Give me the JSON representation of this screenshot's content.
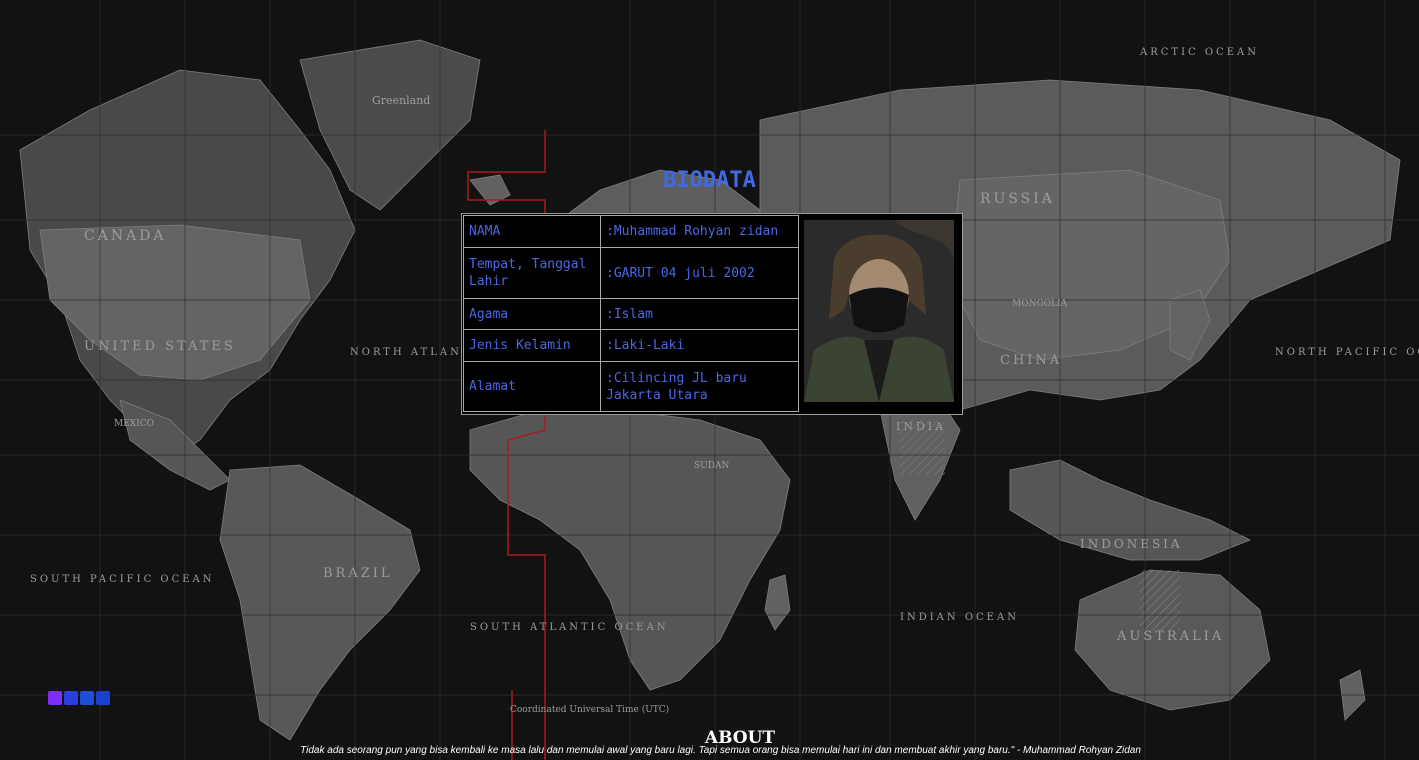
{
  "biodata": {
    "title": "BIODATA",
    "rows": [
      {
        "key": "NAMA",
        "value": ":Muhammad Rohyan zidan"
      },
      {
        "key": "Tempat, Tanggal Lahir",
        "value": ":GARUT 04 juli 2002"
      },
      {
        "key": "Agama",
        "value": ":Islam"
      },
      {
        "key": "Jenis Kelamin",
        "value": ":Laki-Laki"
      },
      {
        "key": "Alamat",
        "value": ":Cilincing JL baru Jakarta Utara"
      }
    ]
  },
  "map": {
    "labels": {
      "greenland": "Greenland",
      "canada": "CANADA",
      "united_states": "UNITED STATES",
      "mexico": "MEXICO",
      "brazil": "BRAZIL",
      "russia": "RUSSIA",
      "china": "CHINA",
      "mongolia": "MONGOLIA",
      "india": "INDIA",
      "australia": "AUSTRALIA",
      "indonesia": "INDONESIA",
      "sudan": "SUDAN",
      "north_atlantic": "NORTH ATLANTIC OCEAN",
      "south_atlantic": "SOUTH ATLANTIC OCEAN",
      "north_pacific": "NORTH PACIFIC OCEAN",
      "south_pacific": "SOUTH PACIFIC OCEAN",
      "indian_ocean": "INDIAN OCEAN",
      "arctic": "ARCTIC OCEAN",
      "utc": "Coordinated Universal Time (UTC)"
    }
  },
  "social": {
    "icons": [
      {
        "name": "facebook-icon",
        "color": "#7b2ff7"
      },
      {
        "name": "twitter-icon",
        "color": "#2a3fe0"
      },
      {
        "name": "instagram-icon",
        "color": "#1f4fd8"
      },
      {
        "name": "linkedin-icon",
        "color": "#1b3fd0"
      }
    ]
  },
  "about": {
    "heading": "ABOUT",
    "quote": "Tidak ada seorang pun yang bisa kembali ke masa lalu dan memulai awal yang baru lagi. Tapi semua orang bisa memulai hari ini dan membuat akhir yang baru.\" - Muhammad Rohyan Zidan"
  },
  "colors": {
    "accent": "#4169e1",
    "table_text": "#4a67e6",
    "background": "#161616"
  }
}
